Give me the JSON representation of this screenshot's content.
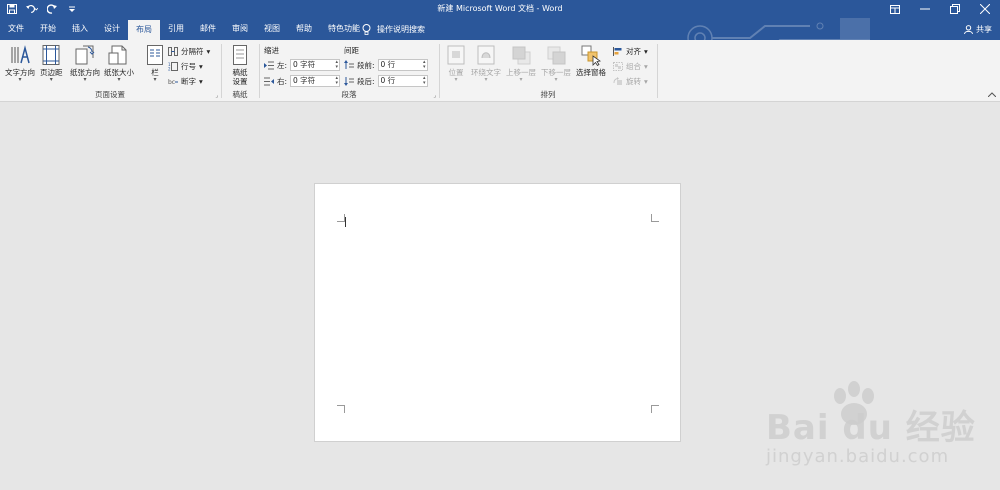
{
  "window": {
    "title": "新建 Microsoft Word 文档 - Word",
    "qat": {
      "save": "save-icon",
      "undo": "undo-icon",
      "redo": "redo-icon",
      "customize": "customize-qat-icon"
    }
  },
  "tabs": [
    "文件",
    "开始",
    "插入",
    "设计",
    "布局",
    "引用",
    "邮件",
    "审阅",
    "视图",
    "帮助",
    "特色功能"
  ],
  "active_tab": "布局",
  "tell_me": "操作说明搜索",
  "share": "共享",
  "ribbon": {
    "page_setup": {
      "label": "页面设置",
      "text_direction": "文字方向",
      "margins": "页边距",
      "orientation": "纸张方向",
      "size": "纸张大小",
      "columns": "栏",
      "breaks": "分隔符",
      "line_numbers": "行号",
      "hyphenation": "断字"
    },
    "draft": {
      "label": "稿纸",
      "settings_line1": "稿纸",
      "settings_line2": "设置"
    },
    "paragraph": {
      "label": "段落",
      "indent_title": "缩进",
      "spacing_title": "间距",
      "left_label": "左:",
      "left_value": "0 字符",
      "right_label": "右:",
      "right_value": "0 字符",
      "before_label": "段前:",
      "before_value": "0 行",
      "after_label": "段后:",
      "after_value": "0 行"
    },
    "arrange": {
      "label": "排列",
      "position": "位置",
      "wrap_text": "环绕文字",
      "bring_forward": "上移一层",
      "send_backward": "下移一层",
      "selection_pane": "选择窗格",
      "align": "对齐",
      "group": "组合",
      "rotate": "旋转"
    }
  },
  "watermark": {
    "main": "Bai du 经验",
    "sub": "jingyan.baidu.com"
  },
  "colors": {
    "accent": "#2b579a",
    "ribbon_bg": "#f3f3f3",
    "canvas_bg": "#e6e6e6"
  }
}
